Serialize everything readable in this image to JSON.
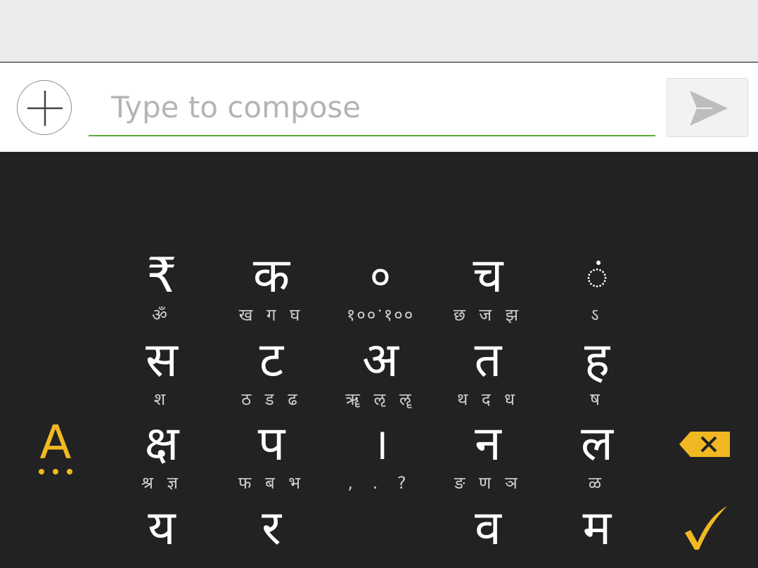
{
  "compose": {
    "placeholder": "Type to compose"
  },
  "keyboard": {
    "rows": [
      [
        {
          "main": "₹",
          "sub": "ॐ"
        },
        {
          "main": "क",
          "sub": "ख ग घ"
        },
        {
          "main": "०",
          "sub": "१००ॱ१००"
        },
        {
          "main": "च",
          "sub": "छ ज झ"
        },
        {
          "main": "◌ं",
          "sub": "ऽ"
        }
      ],
      [
        {
          "main": "स",
          "sub": "श"
        },
        {
          "main": "ट",
          "sub": "ठ ड ढ"
        },
        {
          "main": "अ",
          "sub": "ॠ ऌ ॡ"
        },
        {
          "main": "त",
          "sub": "थ द ध"
        },
        {
          "main": "ह",
          "sub": "ष"
        }
      ],
      [
        {
          "main": "क्ष",
          "sub": "श्र ज्ञ"
        },
        {
          "main": "प",
          "sub": "फ ब भ"
        },
        {
          "main": "।",
          "sub": ", . ?"
        },
        {
          "main": "न",
          "sub": "ङ ण ञ"
        },
        {
          "main": "ल",
          "sub": "ळ"
        }
      ],
      [
        {
          "main": "य",
          "sub": ""
        },
        {
          "main": "र",
          "sub": ""
        },
        {
          "main": "",
          "sub": ""
        },
        {
          "main": "व",
          "sub": ""
        },
        {
          "main": "म",
          "sub": ""
        }
      ]
    ],
    "language_key": {
      "label": "A",
      "icon": "more-dots-icon"
    },
    "backspace": {
      "icon": "backspace-icon"
    },
    "enter": {
      "icon": "checkmark-icon"
    }
  },
  "colors": {
    "accent_yellow": "#f0b923",
    "keyboard_bg": "#222222",
    "input_underline": "#5aa832"
  }
}
